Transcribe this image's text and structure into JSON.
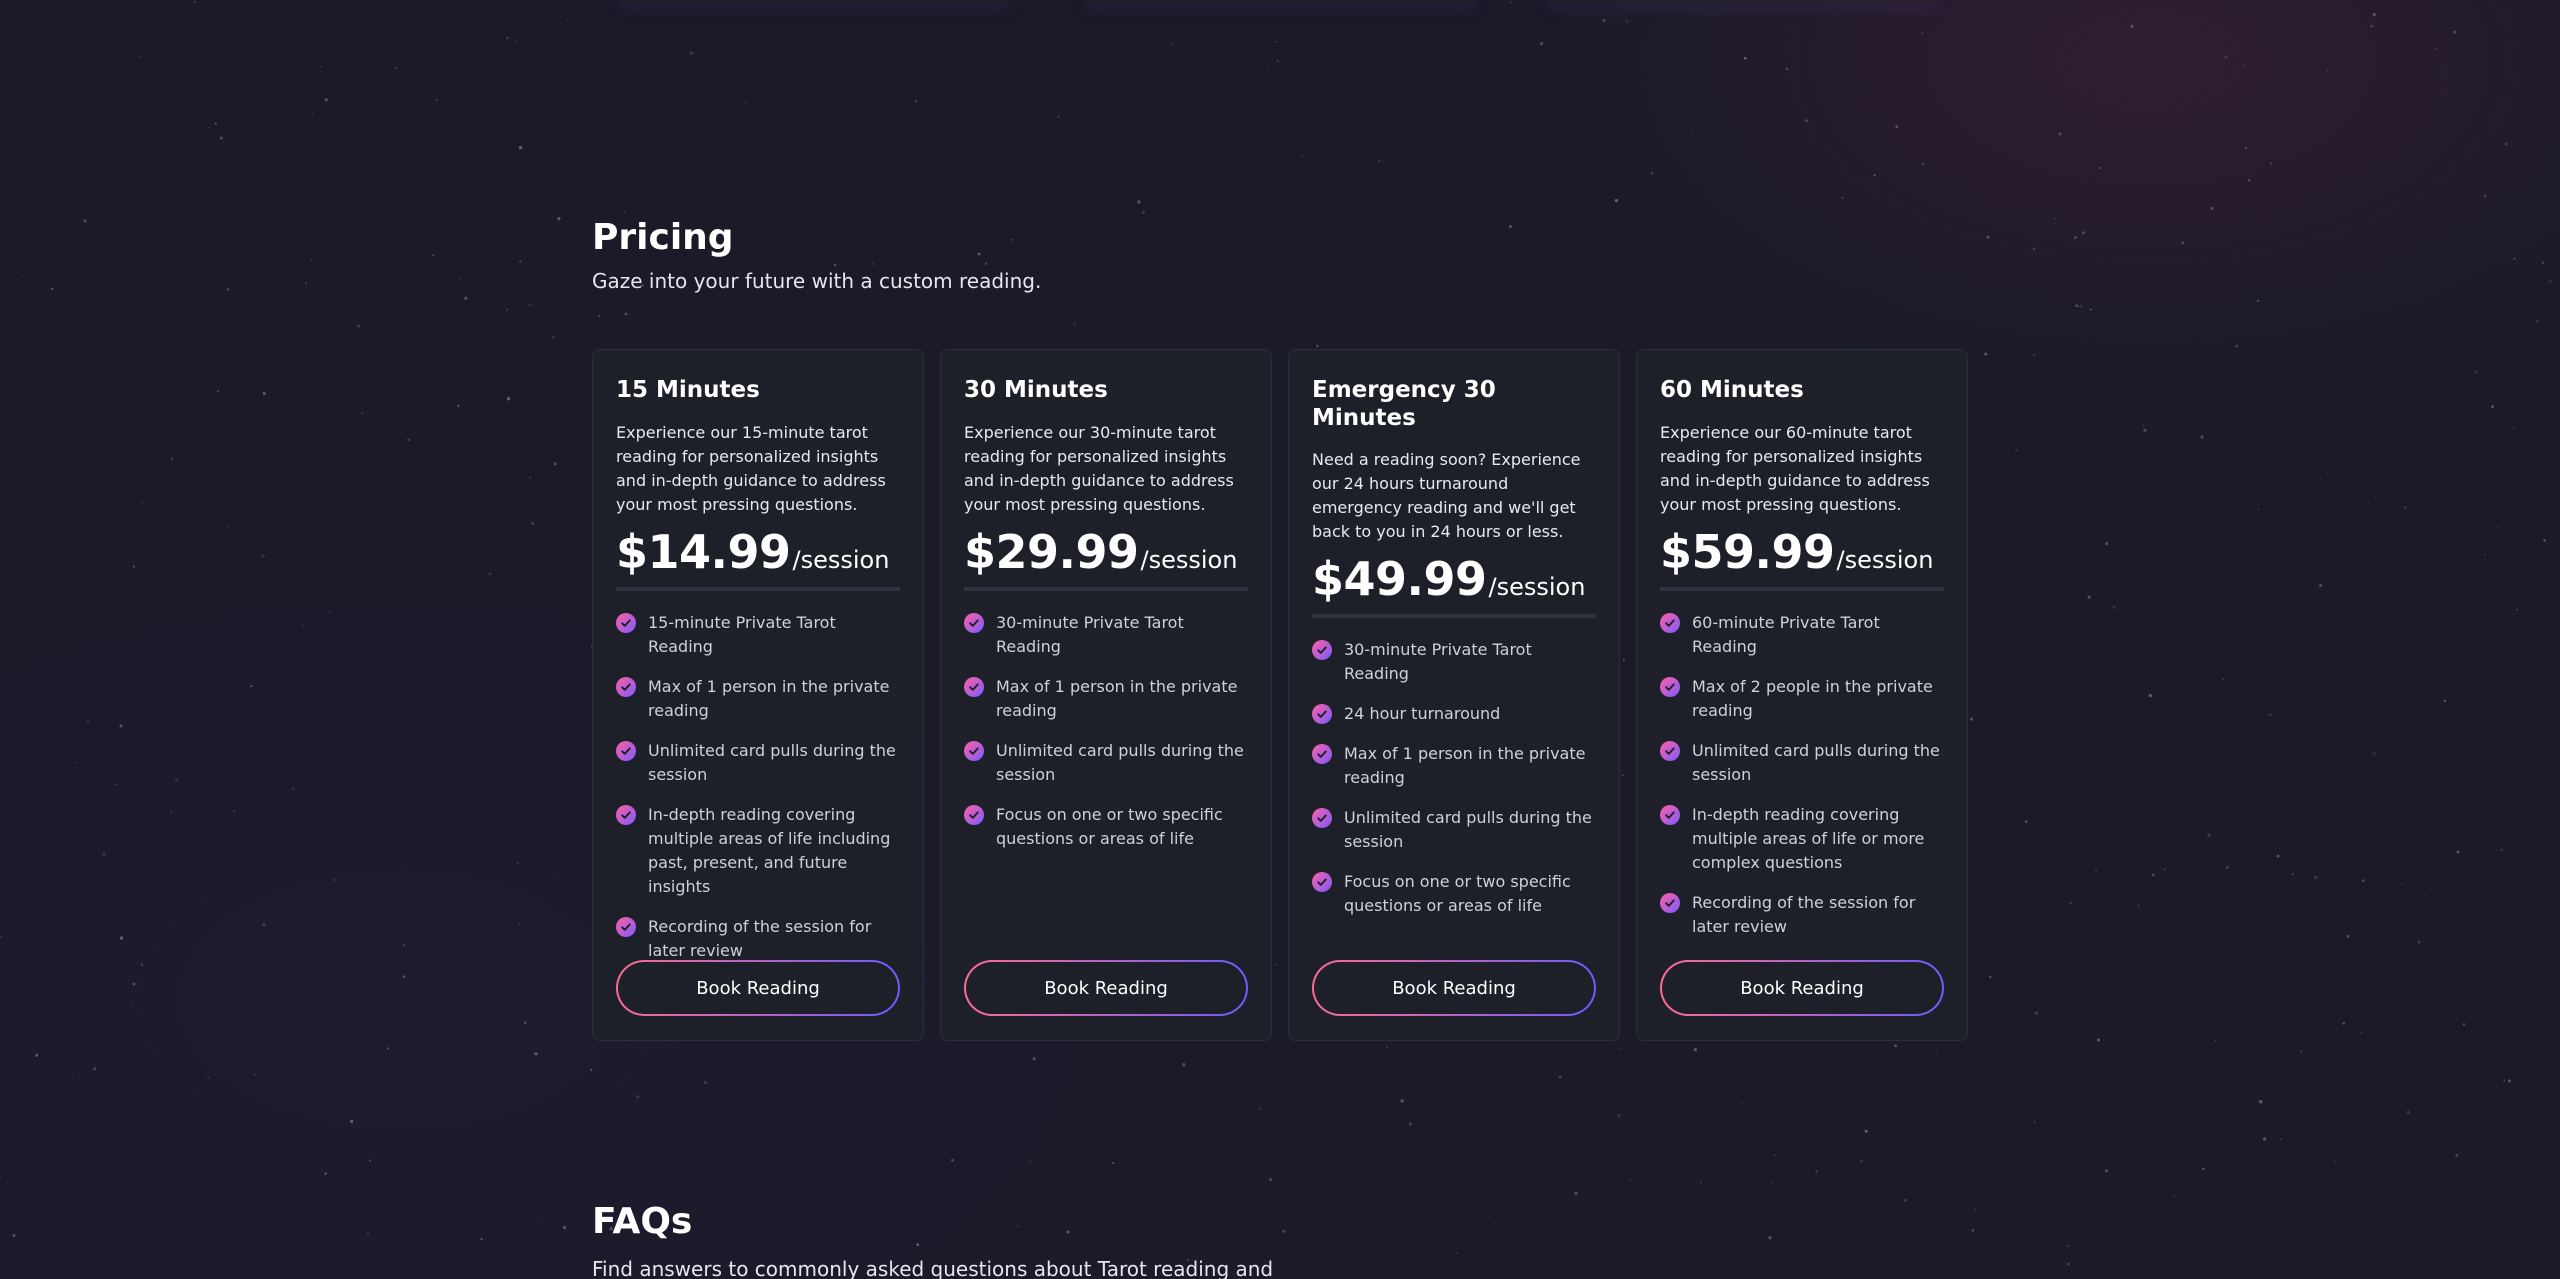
{
  "pricing": {
    "title": "Pricing",
    "subtitle": "Gaze into your future with a custom reading.",
    "cards": [
      {
        "title": "15 Minutes",
        "description": "Experience our 15-minute tarot reading for personalized insights and in-depth guidance to address your most pressing questions.",
        "price": "$14.99",
        "unit": "/session",
        "features": [
          "15-minute Private Tarot Reading",
          "Max of 1 person in the private reading",
          "Unlimited card pulls during the session",
          "In-depth reading covering multiple areas of life including past, present, and future insights",
          "Recording of the session for later review"
        ],
        "button": "Book Reading"
      },
      {
        "title": "30 Minutes",
        "description": "Experience our 30-minute tarot reading for personalized insights and in-depth guidance to address your most pressing questions.",
        "price": "$29.99",
        "unit": "/session",
        "features": [
          "30-minute Private Tarot Reading",
          "Max of 1 person in the private reading",
          "Unlimited card pulls during the session",
          "Focus on one or two specific questions or areas of life"
        ],
        "button": "Book Reading"
      },
      {
        "title": "Emergency 30 Minutes",
        "description": "Need a reading soon? Experience our 24 hours turnaround emergency reading and we'll get back to you in 24 hours or less.",
        "price": "$49.99",
        "unit": "/session",
        "features": [
          "30-minute Private Tarot Reading",
          "24 hour turnaround",
          "Max of 1 person in the private reading",
          "Unlimited card pulls during the session",
          "Focus on one or two specific questions or areas of life"
        ],
        "button": "Book Reading"
      },
      {
        "title": "60 Minutes",
        "description": "Experience our 60-minute tarot reading for personalized insights and in-depth guidance to address your most pressing questions.",
        "price": "$59.99",
        "unit": "/session",
        "features": [
          "60-minute Private Tarot Reading",
          "Max of 2 people in the private reading",
          "Unlimited card pulls during the session",
          "In-depth reading covering multiple areas of life or more complex questions",
          "Recording of the session for later review"
        ],
        "button": "Book Reading"
      }
    ]
  },
  "faqs": {
    "title": "FAQs",
    "subtitle": "Find answers to commonly asked questions about Tarot reading and"
  },
  "icons": {
    "feature_check": "check-circle-icon"
  },
  "colors": {
    "background": "#1a1a28",
    "card": "#1e2029",
    "accent_pink": "#ff6b8f",
    "accent_violet": "#6b5cff"
  }
}
